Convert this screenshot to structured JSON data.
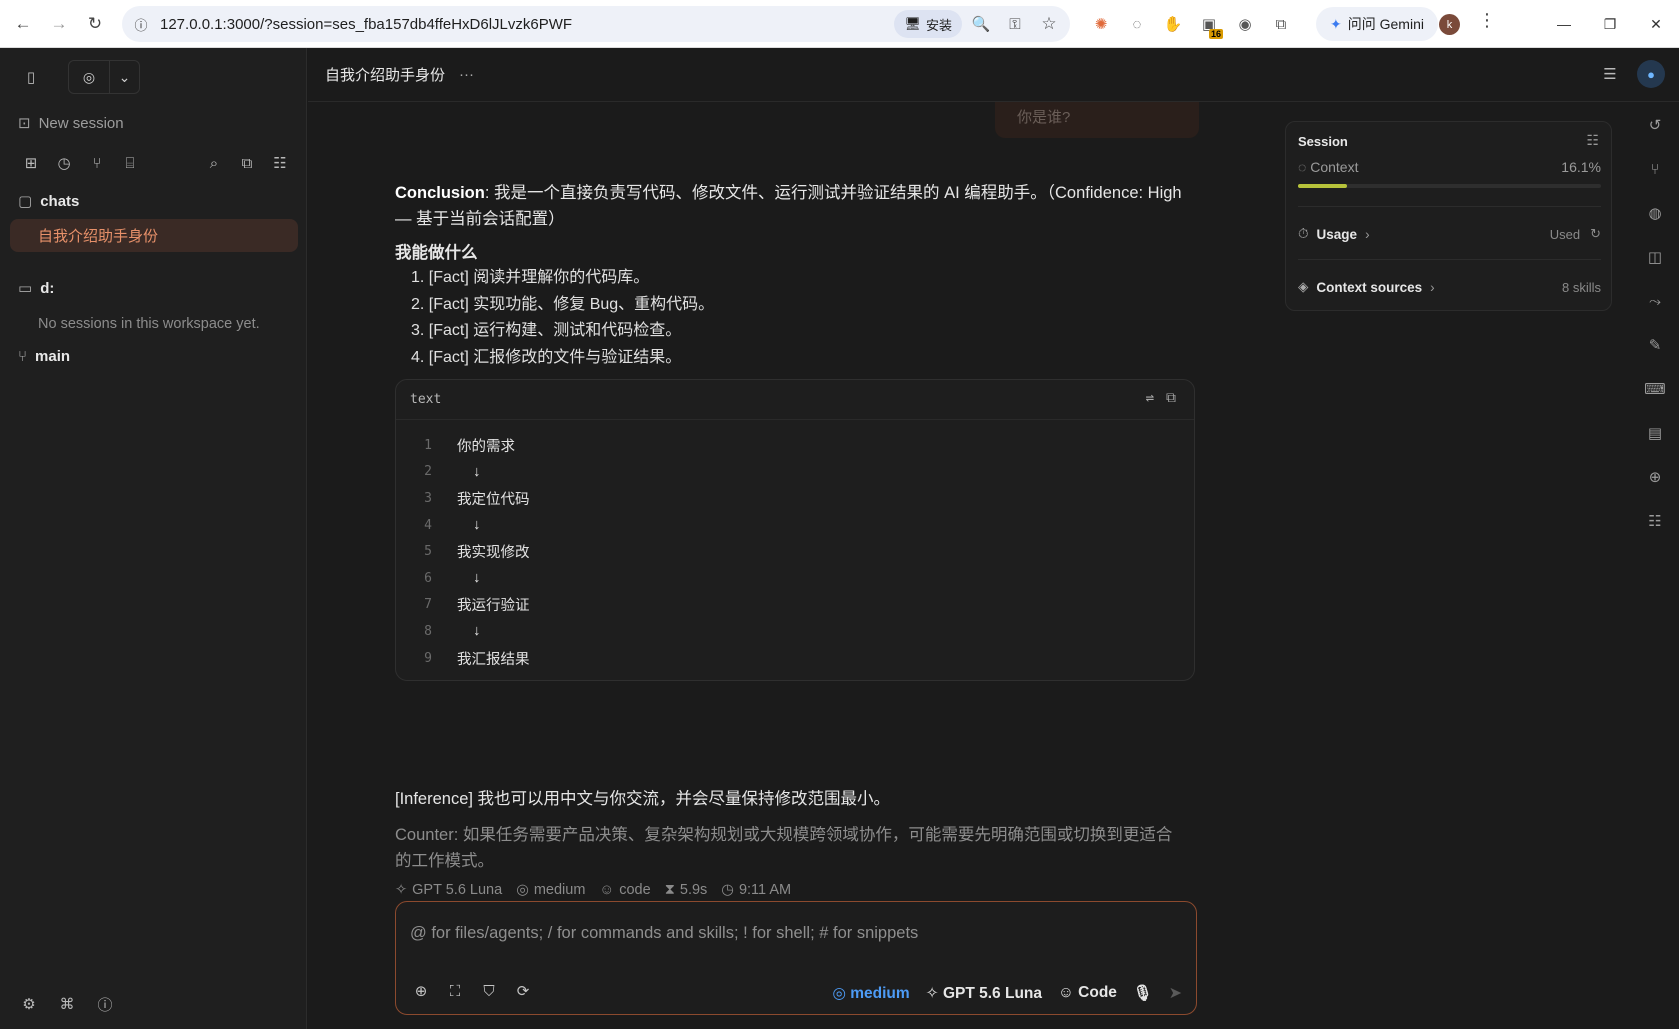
{
  "browser": {
    "url": "127.0.0.1:3000/?session=ses_fba157db4ffeHxD6lJLvzk6PWF",
    "install_label": "安装",
    "gemini_label": "问问 Gemini",
    "ext_badge": "16",
    "avatar_letter": "k"
  },
  "sidebar": {
    "new_session": "New session",
    "chats_label": "chats",
    "active_session": "自我介绍助手身份",
    "workspace_label": "d:",
    "empty_note": "No sessions in this workspace yet.",
    "branch_label": "main"
  },
  "topbar": {
    "title": "自我介绍助手身份",
    "dots": "···"
  },
  "chat": {
    "user_question": "你是谁?",
    "conclusion_label": "Conclusion",
    "conclusion_text": ": 我是一个直接负责写代码、修改文件、运行测试并验证结果的 AI 编程助手。（Confidence: High — 基于当前会话配置）",
    "heading": "我能做什么",
    "list": [
      "1. [Fact] 阅读并理解你的代码库。",
      "2. [Fact] 实现功能、修复 Bug、重构代码。",
      "3. [Fact] 运行构建、测试和代码检查。",
      "4. [Fact] 汇报修改的文件与验证结果。"
    ],
    "code": {
      "lang": "text",
      "lines": [
        {
          "n": "1",
          "t": "你的需求"
        },
        {
          "n": "2",
          "t": "    ↓"
        },
        {
          "n": "3",
          "t": "我定位代码"
        },
        {
          "n": "4",
          "t": "    ↓"
        },
        {
          "n": "5",
          "t": "我实现修改"
        },
        {
          "n": "6",
          "t": "    ↓"
        },
        {
          "n": "7",
          "t": "我运行验证"
        },
        {
          "n": "8",
          "t": "    ↓"
        },
        {
          "n": "9",
          "t": "我汇报结果"
        }
      ]
    },
    "inference": "[Inference] 我也可以用中文与你交流，并会尽量保持修改范围最小。",
    "counter": "Counter: 如果任务需要产品决策、复杂架构规划或大规模跨领域协作，可能需要先明确范围或切换到更适合的工作模式。",
    "meta": {
      "model": "GPT 5.6 Luna",
      "effort": "medium",
      "mode": "code",
      "duration": "5.9s",
      "time": "9:11 AM"
    }
  },
  "composer": {
    "placeholder": "@ for files/agents; / for commands and skills; ! for shell; # for snippets",
    "effort": "medium",
    "model": "GPT 5.6 Luna",
    "mode": "Code"
  },
  "panel": {
    "title": "Session",
    "context_label": "Context",
    "context_value": "16.1%",
    "context_fraction": 0.161,
    "usage_label": "Usage",
    "usage_value": "Used",
    "sources_label": "Context sources",
    "sources_value": "8 skills"
  },
  "colors": {
    "accent": "#e8916a",
    "context_bar": "#b6c23a",
    "link_blue": "#4d9bf5"
  }
}
